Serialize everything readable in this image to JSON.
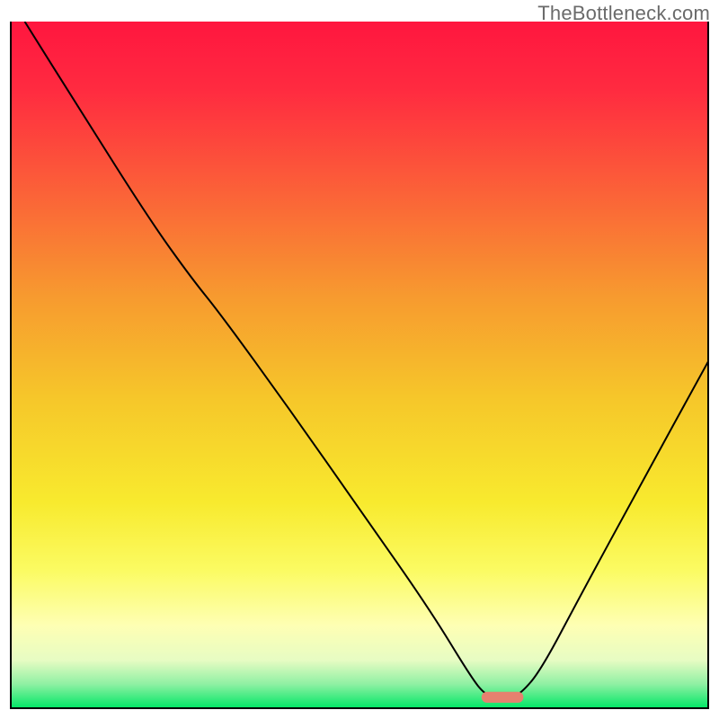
{
  "watermark": {
    "text": "TheBottleneck.com"
  },
  "colors": {
    "gradient_stops": [
      {
        "offset": 0.0,
        "color": "#ff163f"
      },
      {
        "offset": 0.1,
        "color": "#ff2b40"
      },
      {
        "offset": 0.25,
        "color": "#fb6238"
      },
      {
        "offset": 0.4,
        "color": "#f79a2f"
      },
      {
        "offset": 0.55,
        "color": "#f6c72a"
      },
      {
        "offset": 0.7,
        "color": "#f8ea2e"
      },
      {
        "offset": 0.8,
        "color": "#fbfb63"
      },
      {
        "offset": 0.88,
        "color": "#feffb4"
      },
      {
        "offset": 0.93,
        "color": "#e7fcc3"
      },
      {
        "offset": 0.965,
        "color": "#8ff0a3"
      },
      {
        "offset": 1.0,
        "color": "#00e765"
      }
    ],
    "curve_stroke": "#000000",
    "marker_fill": "#e6816f",
    "frame_stroke": "#000000"
  },
  "chart_data": {
    "type": "line",
    "title": "",
    "xlabel": "",
    "ylabel": "",
    "xlim": [
      0,
      100
    ],
    "ylim": [
      0,
      100
    ],
    "series": [
      {
        "name": "bottleneck-curve",
        "points": [
          {
            "x": 2.0,
            "y": 100.0
          },
          {
            "x": 10.0,
            "y": 87.0
          },
          {
            "x": 20.0,
            "y": 71.0
          },
          {
            "x": 26.0,
            "y": 62.5
          },
          {
            "x": 30.0,
            "y": 57.5
          },
          {
            "x": 40.0,
            "y": 43.5
          },
          {
            "x": 50.0,
            "y": 29.0
          },
          {
            "x": 60.0,
            "y": 14.5
          },
          {
            "x": 66.0,
            "y": 4.5
          },
          {
            "x": 68.0,
            "y": 2.0
          },
          {
            "x": 69.5,
            "y": 1.6
          },
          {
            "x": 71.5,
            "y": 1.6
          },
          {
            "x": 73.0,
            "y": 2.0
          },
          {
            "x": 76.0,
            "y": 5.5
          },
          {
            "x": 82.0,
            "y": 17.0
          },
          {
            "x": 90.0,
            "y": 32.0
          },
          {
            "x": 100.0,
            "y": 50.5
          }
        ]
      }
    ],
    "marker": {
      "name": "optimal-range",
      "x_center": 70.5,
      "y": 1.6,
      "width": 6.0,
      "height": 1.6
    },
    "gradient_axis": "vertical",
    "gradient_meaning": "red-high → green-low (lower is better / sweet spot at bottom)"
  }
}
